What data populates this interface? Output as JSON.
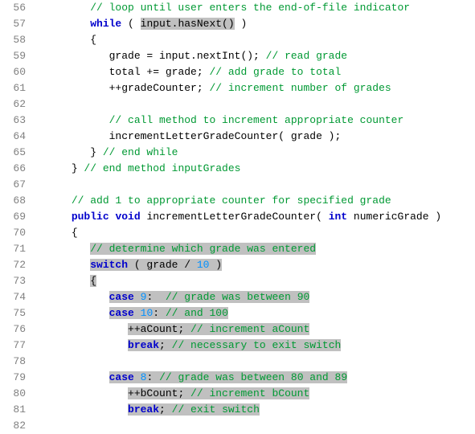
{
  "lines": [
    {
      "n": 56,
      "seg": [
        [
          "sp",
          "         "
        ],
        [
          "cm",
          "// loop until user enters the end-of-file indicator"
        ]
      ]
    },
    {
      "n": 57,
      "seg": [
        [
          "sp",
          "         "
        ],
        [
          "kw",
          "while"
        ],
        [
          "id",
          " ( "
        ],
        [
          "hl-id",
          "input.hasNext()"
        ],
        [
          "id",
          " )"
        ]
      ]
    },
    {
      "n": 58,
      "seg": [
        [
          "sp",
          "         "
        ],
        [
          "id",
          "{"
        ]
      ]
    },
    {
      "n": 59,
      "seg": [
        [
          "sp",
          "            "
        ],
        [
          "id",
          "grade = input.nextInt(); "
        ],
        [
          "cm",
          "// read grade"
        ]
      ]
    },
    {
      "n": 60,
      "seg": [
        [
          "sp",
          "            "
        ],
        [
          "id",
          "total += grade; "
        ],
        [
          "cm",
          "// add grade to total"
        ]
      ]
    },
    {
      "n": 61,
      "seg": [
        [
          "sp",
          "            "
        ],
        [
          "id",
          "++gradeCounter; "
        ],
        [
          "cm",
          "// increment number of grades"
        ]
      ]
    },
    {
      "n": 62,
      "seg": [
        [
          "sp",
          ""
        ]
      ]
    },
    {
      "n": 63,
      "seg": [
        [
          "sp",
          "            "
        ],
        [
          "cm",
          "// call method to increment appropriate counter"
        ]
      ]
    },
    {
      "n": 64,
      "seg": [
        [
          "sp",
          "            "
        ],
        [
          "id",
          "incrementLetterGradeCounter( grade );"
        ]
      ]
    },
    {
      "n": 65,
      "seg": [
        [
          "sp",
          "         "
        ],
        [
          "id",
          "} "
        ],
        [
          "cm",
          "// end while"
        ]
      ]
    },
    {
      "n": 66,
      "seg": [
        [
          "sp",
          "      "
        ],
        [
          "id",
          "} "
        ],
        [
          "cm",
          "// end method inputGrades"
        ]
      ]
    },
    {
      "n": 67,
      "seg": [
        [
          "sp",
          ""
        ]
      ]
    },
    {
      "n": 68,
      "seg": [
        [
          "sp",
          "      "
        ],
        [
          "cm",
          "// add 1 to appropriate counter for specified grade"
        ]
      ]
    },
    {
      "n": 69,
      "seg": [
        [
          "sp",
          "      "
        ],
        [
          "kw",
          "public"
        ],
        [
          "id",
          " "
        ],
        [
          "kw",
          "void"
        ],
        [
          "id",
          " incrementLetterGradeCounter( "
        ],
        [
          "kw",
          "int"
        ],
        [
          "id",
          " numericGrade )"
        ]
      ]
    },
    {
      "n": 70,
      "seg": [
        [
          "sp",
          "      "
        ],
        [
          "id",
          "{"
        ]
      ]
    },
    {
      "n": 71,
      "seg": [
        [
          "sp",
          "         "
        ],
        [
          "hl-cm",
          "// determine which grade was entered"
        ]
      ]
    },
    {
      "n": 72,
      "seg": [
        [
          "sp",
          "         "
        ],
        [
          "hl-kw",
          "switch"
        ],
        [
          "hl-id",
          " ( grade / "
        ],
        [
          "hl-num",
          "10"
        ],
        [
          "hl-id",
          " )"
        ]
      ]
    },
    {
      "n": 73,
      "seg": [
        [
          "sp",
          "         "
        ],
        [
          "hl-id",
          "{"
        ]
      ]
    },
    {
      "n": 74,
      "seg": [
        [
          "sp",
          "            "
        ],
        [
          "hl-kw",
          "case"
        ],
        [
          "hl-id",
          " "
        ],
        [
          "hl-num",
          "9"
        ],
        [
          "hl-id",
          ":  "
        ],
        [
          "hl-cm",
          "// grade was between 90"
        ]
      ]
    },
    {
      "n": 75,
      "seg": [
        [
          "sp",
          "            "
        ],
        [
          "hl-kw",
          "case"
        ],
        [
          "hl-id",
          " "
        ],
        [
          "hl-num",
          "10"
        ],
        [
          "hl-id",
          ": "
        ],
        [
          "hl-cm",
          "// and 100"
        ]
      ]
    },
    {
      "n": 76,
      "seg": [
        [
          "sp",
          "               "
        ],
        [
          "hl-id",
          "++aCount; "
        ],
        [
          "hl-cm",
          "// increment aCount"
        ]
      ]
    },
    {
      "n": 77,
      "seg": [
        [
          "sp",
          "               "
        ],
        [
          "hl-kw",
          "break"
        ],
        [
          "hl-id",
          "; "
        ],
        [
          "hl-cm",
          "// necessary to exit switch"
        ]
      ]
    },
    {
      "n": 78,
      "seg": [
        [
          "sp",
          ""
        ]
      ]
    },
    {
      "n": 79,
      "seg": [
        [
          "sp",
          "            "
        ],
        [
          "hl-kw",
          "case"
        ],
        [
          "hl-id",
          " "
        ],
        [
          "hl-num",
          "8"
        ],
        [
          "hl-id",
          ": "
        ],
        [
          "hl-cm",
          "// grade was between 80 and 89"
        ]
      ]
    },
    {
      "n": 80,
      "seg": [
        [
          "sp",
          "               "
        ],
        [
          "hl-id",
          "++bCount; "
        ],
        [
          "hl-cm",
          "// increment bCount"
        ]
      ]
    },
    {
      "n": 81,
      "seg": [
        [
          "sp",
          "               "
        ],
        [
          "hl-kw",
          "break"
        ],
        [
          "hl-id",
          "; "
        ],
        [
          "hl-cm",
          "// exit switch"
        ]
      ]
    },
    {
      "n": 82,
      "seg": [
        [
          "sp",
          ""
        ]
      ]
    }
  ]
}
